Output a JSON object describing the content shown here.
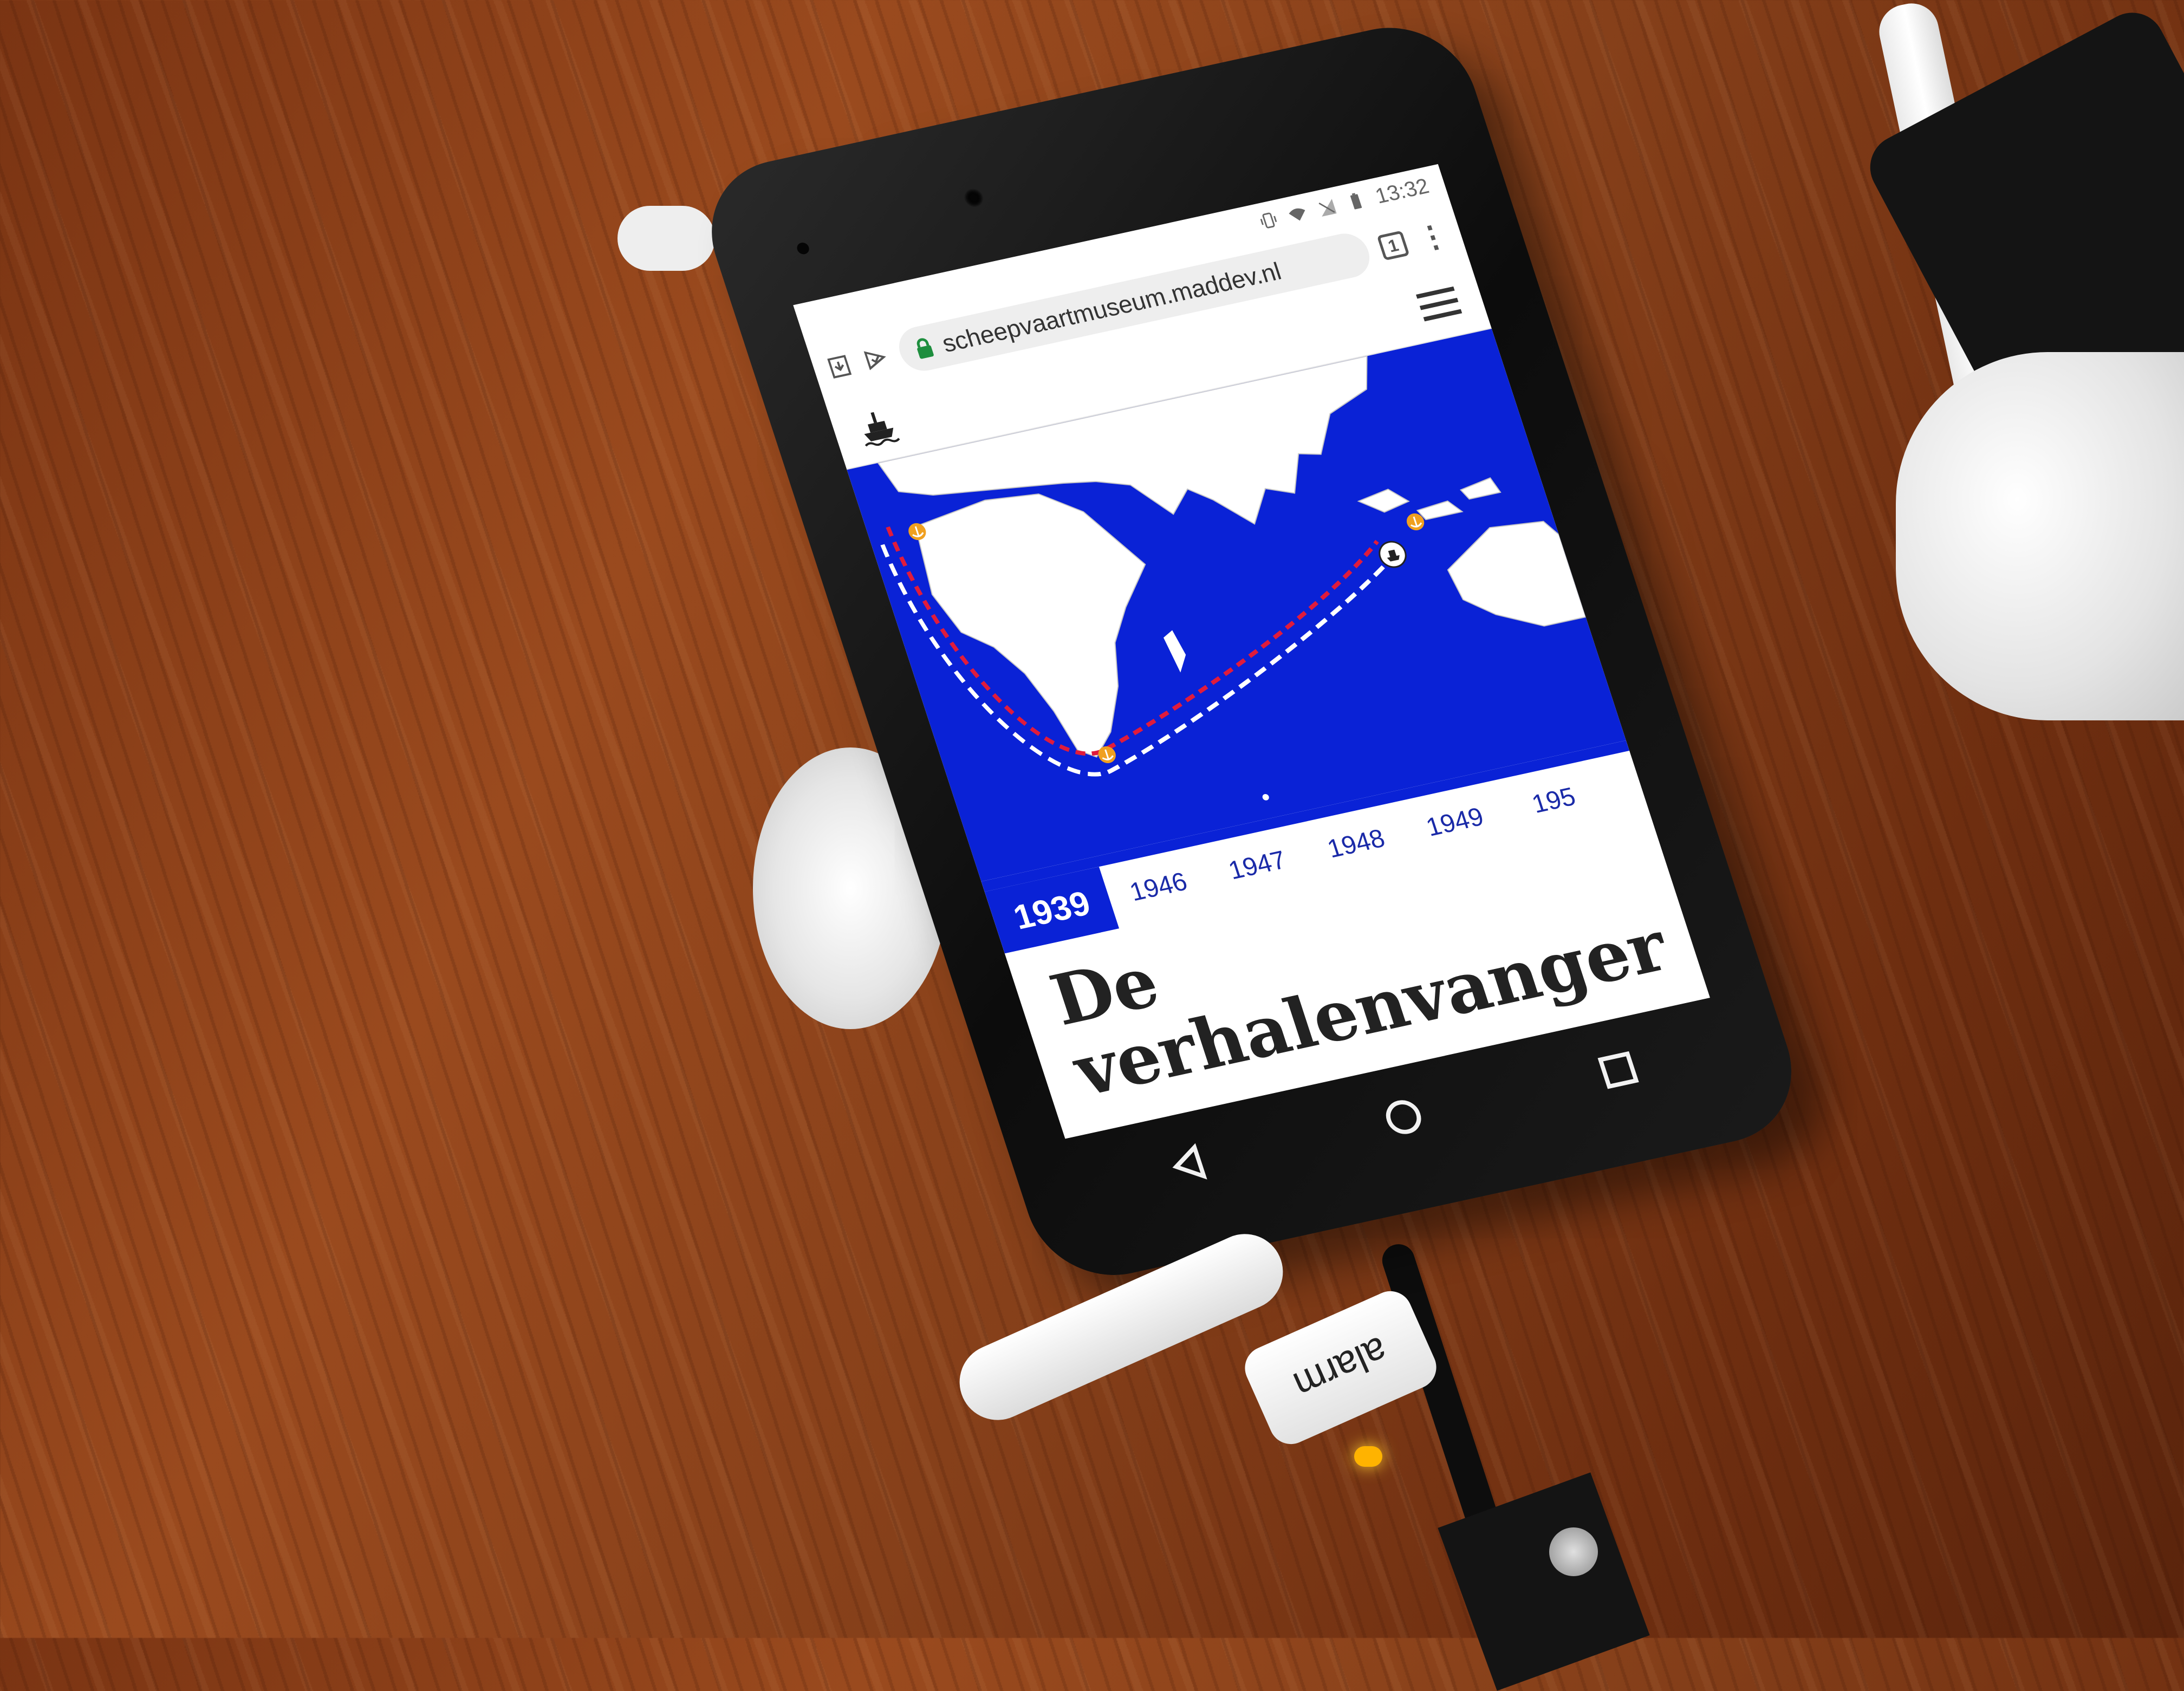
{
  "status_bar": {
    "time": "13:32"
  },
  "browser": {
    "url": "scheepvaartmuseum.maddev.nl",
    "tab_count": "1"
  },
  "timeline": {
    "active_year": "1939",
    "years": [
      "1946",
      "1947",
      "1948",
      "1949",
      "195"
    ]
  },
  "article": {
    "title_line1": "De",
    "title_line2": "verhalenvanger"
  },
  "device_tag": {
    "label": "alarm"
  },
  "colors": {
    "map_ocean": "#0a22d6",
    "land": "#ffffff",
    "route_red": "#e01b3c",
    "route_white": "#ffffff",
    "anchor": "#f0a020"
  },
  "icons": [
    "download-icon",
    "check-icon",
    "vibrate-icon",
    "wifi-icon",
    "no-signal-icon",
    "battery-icon",
    "lock-icon",
    "hamburger-menu-icon",
    "ship-logo-icon",
    "anchor-icon",
    "back-icon",
    "home-icon",
    "recents-icon"
  ]
}
